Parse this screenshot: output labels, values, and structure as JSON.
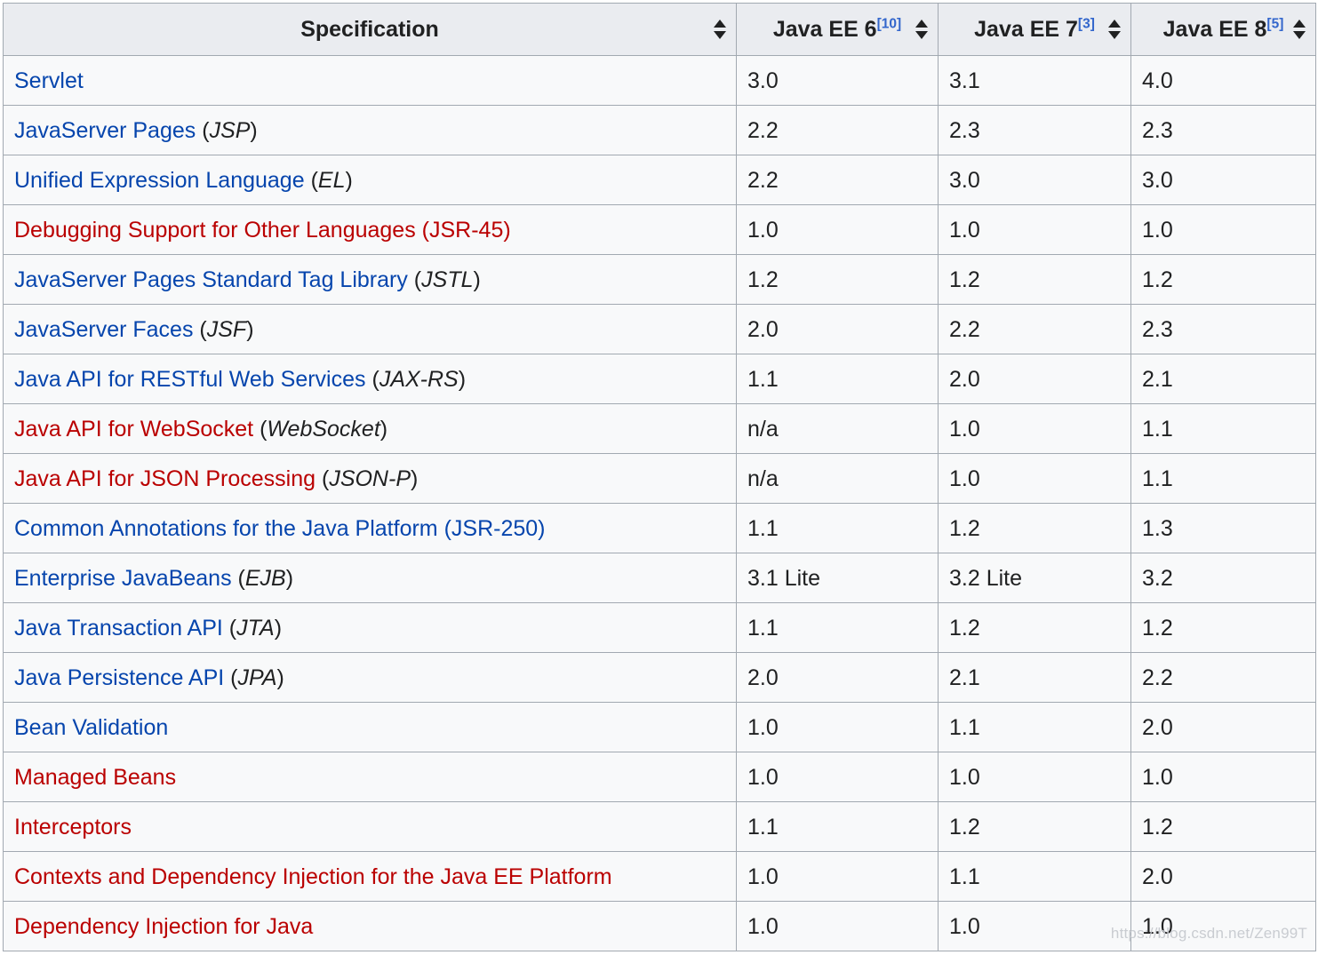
{
  "table": {
    "columns": [
      {
        "label": "Specification",
        "ref": "",
        "sortable": true,
        "align": "center"
      },
      {
        "label": "Java EE 6",
        "ref": "[10]",
        "sortable": true,
        "align": "left"
      },
      {
        "label": "Java EE 7",
        "ref": "[3]",
        "sortable": true,
        "align": "left"
      },
      {
        "label": "Java EE 8",
        "ref": "[5]",
        "sortable": true,
        "align": "left"
      }
    ],
    "rows": [
      {
        "name": "Servlet",
        "abbr": "",
        "link": "blue",
        "ee6": "3.0",
        "ee7": "3.1",
        "ee8": "4.0"
      },
      {
        "name": "JavaServer Pages",
        "abbr": "JSP",
        "link": "blue",
        "ee6": "2.2",
        "ee7": "2.3",
        "ee8": "2.3"
      },
      {
        "name": "Unified Expression Language",
        "abbr": "EL",
        "link": "blue",
        "ee6": "2.2",
        "ee7": "3.0",
        "ee8": "3.0"
      },
      {
        "name": "Debugging Support for Other Languages (JSR-45)",
        "abbr": "",
        "link": "red",
        "ee6": "1.0",
        "ee7": "1.0",
        "ee8": "1.0"
      },
      {
        "name": "JavaServer Pages Standard Tag Library",
        "abbr": "JSTL",
        "link": "blue",
        "ee6": "1.2",
        "ee7": "1.2",
        "ee8": "1.2"
      },
      {
        "name": "JavaServer Faces",
        "abbr": "JSF",
        "link": "blue",
        "ee6": "2.0",
        "ee7": "2.2",
        "ee8": "2.3"
      },
      {
        "name": "Java API for RESTful Web Services",
        "abbr": "JAX-RS",
        "link": "blue",
        "ee6": "1.1",
        "ee7": "2.0",
        "ee8": "2.1"
      },
      {
        "name": "Java API for WebSocket",
        "abbr": "WebSocket",
        "link": "red",
        "ee6": "n/a",
        "ee7": "1.0",
        "ee8": "1.1"
      },
      {
        "name": "Java API for JSON Processing",
        "abbr": "JSON-P",
        "link": "red",
        "ee6": "n/a",
        "ee7": "1.0",
        "ee8": "1.1"
      },
      {
        "name": "Common Annotations for the Java Platform (JSR-250)",
        "abbr": "",
        "link": "blue",
        "ee6": "1.1",
        "ee7": "1.2",
        "ee8": "1.3"
      },
      {
        "name": "Enterprise JavaBeans",
        "abbr": "EJB",
        "link": "blue",
        "ee6": "3.1 Lite",
        "ee7": "3.2 Lite",
        "ee8": "3.2"
      },
      {
        "name": "Java Transaction API",
        "abbr": "JTA",
        "link": "blue",
        "ee6": "1.1",
        "ee7": "1.2",
        "ee8": "1.2"
      },
      {
        "name": "Java Persistence API",
        "abbr": "JPA",
        "link": "blue",
        "ee6": "2.0",
        "ee7": "2.1",
        "ee8": "2.2"
      },
      {
        "name": "Bean Validation",
        "abbr": "",
        "link": "blue",
        "ee6": "1.0",
        "ee7": "1.1",
        "ee8": "2.0"
      },
      {
        "name": "Managed Beans",
        "abbr": "",
        "link": "red",
        "ee6": "1.0",
        "ee7": "1.0",
        "ee8": "1.0"
      },
      {
        "name": "Interceptors",
        "abbr": "",
        "link": "red",
        "ee6": "1.1",
        "ee7": "1.2",
        "ee8": "1.2"
      },
      {
        "name": "Contexts and Dependency Injection for the Java EE Platform",
        "abbr": "",
        "link": "red",
        "ee6": "1.0",
        "ee7": "1.1",
        "ee8": "2.0"
      },
      {
        "name": "Dependency Injection for Java",
        "abbr": "",
        "link": "red",
        "ee6": "1.0",
        "ee7": "1.0",
        "ee8": "1.0"
      }
    ]
  },
  "watermark": "https://blog.csdn.net/Zen99T",
  "colors": {
    "link_blue": "#0645ad",
    "link_red": "#ba0000",
    "header_bg": "#eaecf0",
    "cell_bg": "#f8f9fa",
    "border": "#a2a9b1",
    "ref_blue": "#3366cc"
  }
}
